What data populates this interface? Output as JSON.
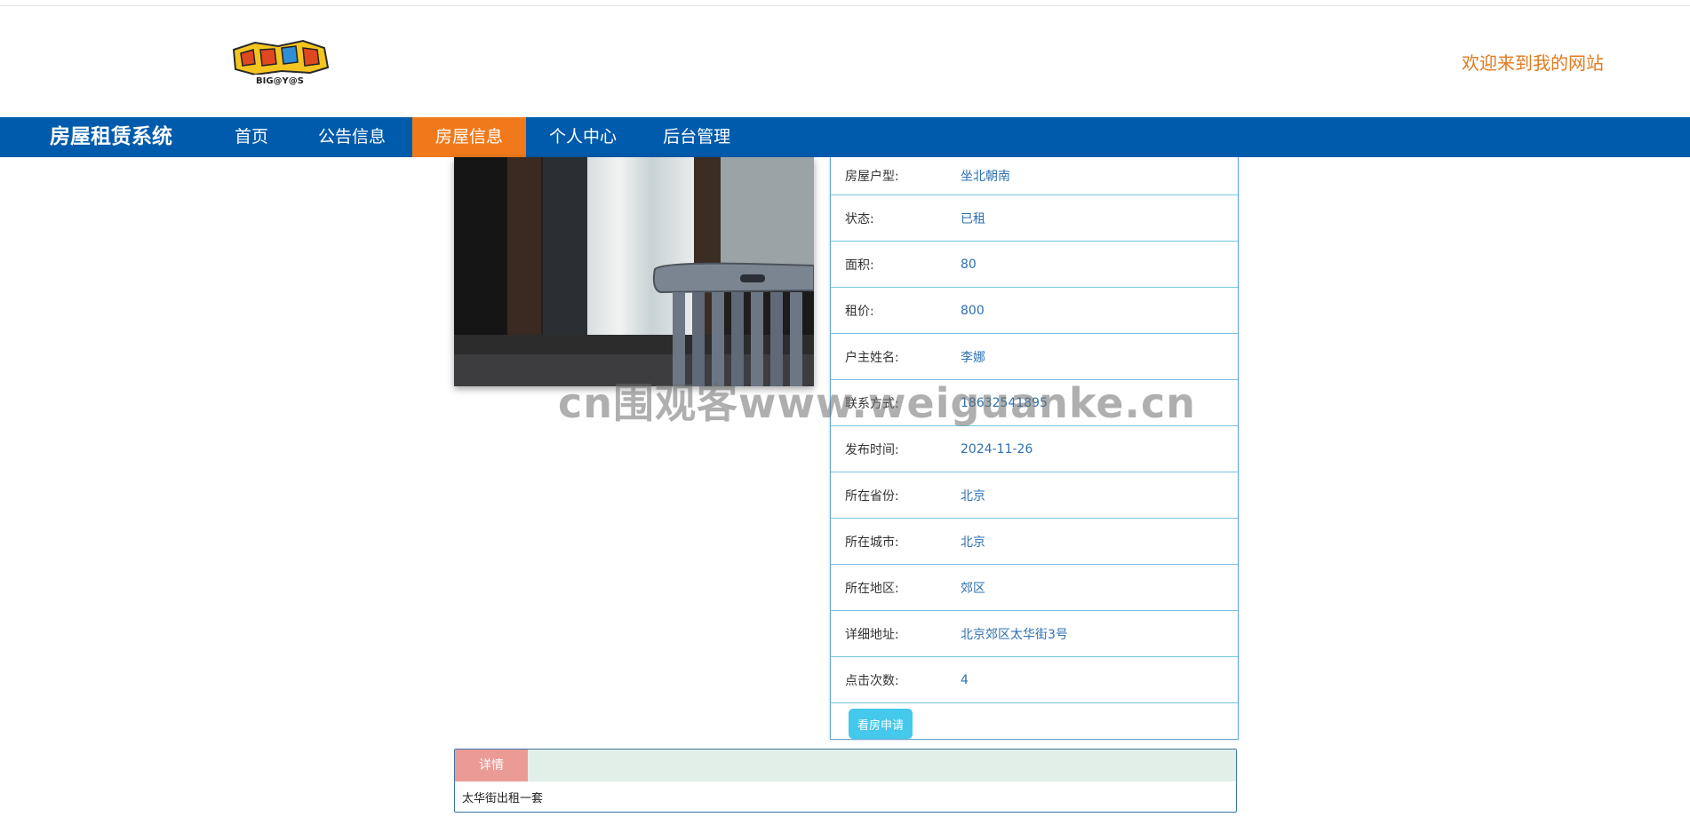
{
  "header": {
    "logo_text": "BIG@Y@S",
    "welcome": "欢迎来到我的网站"
  },
  "navbar": {
    "brand": "房屋租赁系统",
    "items": [
      {
        "label": "首页",
        "active": false
      },
      {
        "label": "公告信息",
        "active": false
      },
      {
        "label": "房屋信息",
        "active": true
      },
      {
        "label": "个人中心",
        "active": false
      },
      {
        "label": "后台管理",
        "active": false
      }
    ]
  },
  "house": {
    "rows": [
      {
        "label": "房屋户型:",
        "value": "坐北朝南"
      },
      {
        "label": "状态:",
        "value": "已租"
      },
      {
        "label": "面积:",
        "value": "80"
      },
      {
        "label": "租价:",
        "value": "800"
      },
      {
        "label": "户主姓名:",
        "value": "李娜"
      },
      {
        "label": "联系方式:",
        "value": "18632541895"
      },
      {
        "label": "发布时间:",
        "value": "2024-11-26"
      },
      {
        "label": "所在省份:",
        "value": "北京"
      },
      {
        "label": "所在城市:",
        "value": "北京"
      },
      {
        "label": "所在地区:",
        "value": "郊区"
      },
      {
        "label": "详细地址:",
        "value": "北京郊区太华街3号"
      },
      {
        "label": "点击次数:",
        "value": "4"
      }
    ],
    "apply_label": "看房申请"
  },
  "detail": {
    "tab": "详情",
    "content": "太华街出租一套"
  },
  "watermark": "cn围观客www.weiguanke.cn"
}
